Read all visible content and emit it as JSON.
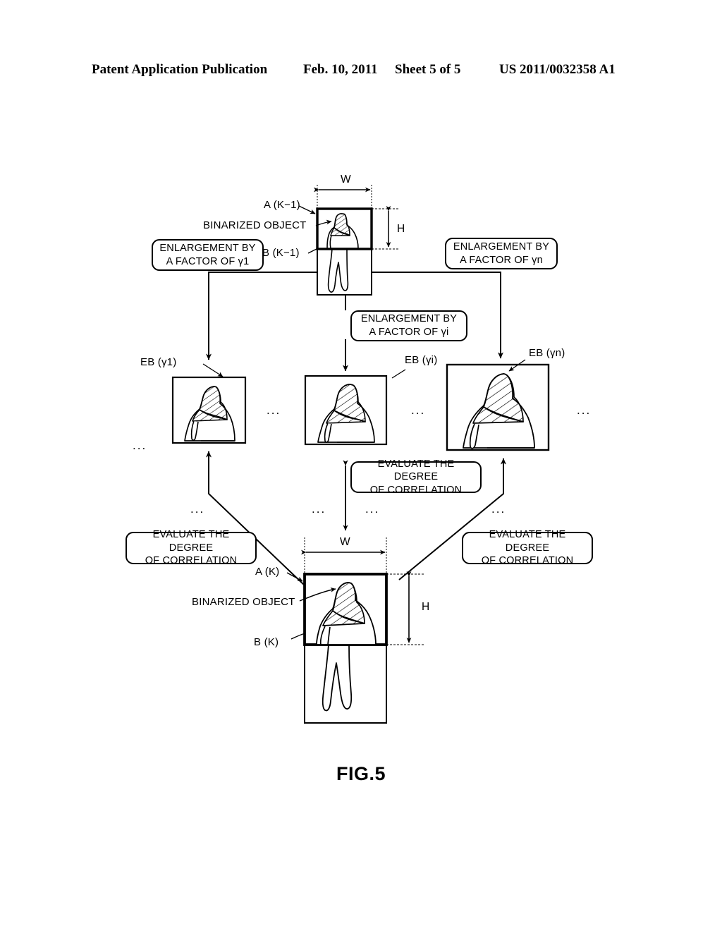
{
  "header": {
    "publication": "Patent Application Publication",
    "date": "Feb. 10, 2011",
    "sheet": "Sheet 5 of 5",
    "number": "US 2011/0032358 A1"
  },
  "figure": {
    "caption": "FIG.5"
  },
  "labels": {
    "a_k_minus_1": "A (K−1)",
    "b_k_minus_1": "B (K−1)",
    "a_k": "A (K)",
    "b_k": "B (K)",
    "binarized_object_top": "BINARIZED OBJECT",
    "binarized_object_bottom": "BINARIZED OBJECT",
    "width_top": "W",
    "height_top": "H",
    "width_bottom": "W",
    "height_bottom": "H",
    "eb_gamma_1": "EB (γ1)",
    "eb_gamma_i": "EB (γi)",
    "eb_gamma_n": "EB (γn)",
    "ellipsis": "..."
  },
  "process_boxes": {
    "enlargement_gamma_1": "ENLARGEMENT BY\nA FACTOR OF γ1",
    "enlargement_gamma_i": "ENLARGEMENT BY\nA FACTOR OF γi",
    "enlargement_gamma_n": "ENLARGEMENT BY\nA FACTOR OF γn",
    "evaluate_left": "EVALUATE THE DEGREE\nOF CORRELATION",
    "evaluate_center": "EVALUATE THE DEGREE\nOF CORRELATION",
    "evaluate_right": "EVALUATE THE DEGREE\nOF CORRELATION"
  },
  "colors": {
    "ink": "#000000",
    "paper": "#ffffff"
  }
}
